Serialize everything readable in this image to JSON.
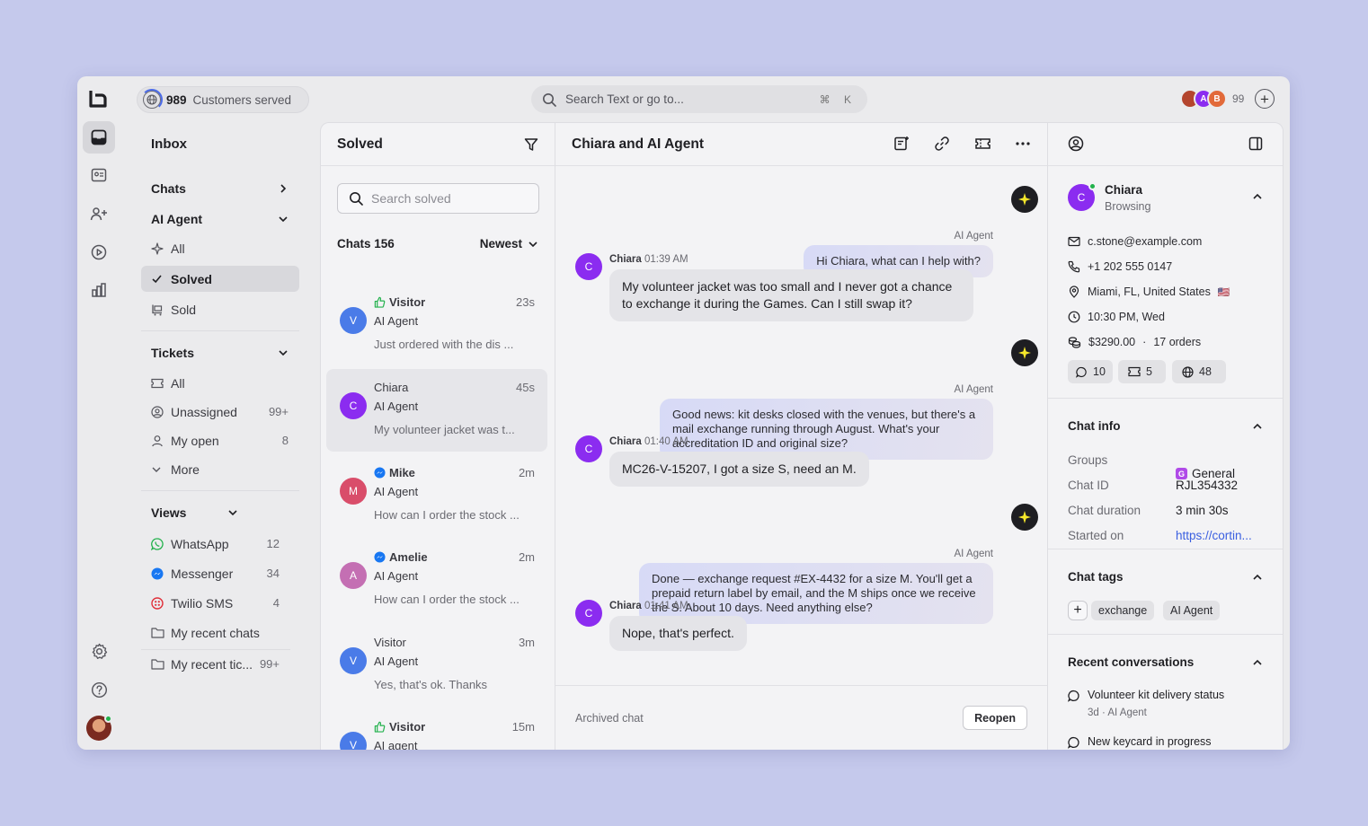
{
  "topbar": {
    "customers_count": "989",
    "customers_label": "Customers served",
    "search_placeholder": "Search Text or go to...",
    "search_shortcut": "⌘ K",
    "team_avatars": [
      {
        "initial": "",
        "color": "#b4452e"
      },
      {
        "initial": "A",
        "color": "#8b2cf0"
      },
      {
        "initial": "B",
        "color": "#e26a3a"
      }
    ],
    "team_count": "99"
  },
  "sidebar": {
    "title": "Inbox",
    "chats": "Chats",
    "ai_agent": "AI Agent",
    "ai_items": [
      {
        "label": "All",
        "icon": "sparkle-icon"
      },
      {
        "label": "Solved",
        "icon": "check-icon"
      },
      {
        "label": "Sold",
        "icon": "cart-icon"
      }
    ],
    "tickets": "Tickets",
    "ticket_items": [
      {
        "label": "All",
        "icon": "ticket-icon",
        "count": ""
      },
      {
        "label": "Unassigned",
        "icon": "user-circle-icon",
        "count": "99+"
      },
      {
        "label": "My open",
        "icon": "user-icon",
        "count": "8"
      },
      {
        "label": "More",
        "icon": "chevron-down-icon",
        "count": ""
      }
    ],
    "views": "Views",
    "view_items": [
      {
        "label": "WhatsApp",
        "count": "12"
      },
      {
        "label": "Messenger",
        "count": "34"
      },
      {
        "label": "Twilio SMS",
        "count": "4"
      },
      {
        "label": "My recent chats",
        "count": ""
      },
      {
        "label": "My recent tic...",
        "count": "99+"
      }
    ]
  },
  "list": {
    "title": "Solved",
    "search_placeholder": "Search solved",
    "count_label": "Chats 156",
    "sort": "Newest",
    "items": [
      {
        "initial": "V",
        "color": "#4a7be8",
        "name": "Visitor",
        "channel": "whatsapp",
        "time": "23s",
        "agent": "AI Agent",
        "preview": "Just ordered with the dis ..."
      },
      {
        "initial": "C",
        "color": "#8b2cf0",
        "name": "Chiara",
        "channel": "",
        "time": "45s",
        "agent": "AI Agent",
        "preview": "My volunteer jacket was t..."
      },
      {
        "initial": "M",
        "color": "#d94d6a",
        "name": "Mike",
        "channel": "messenger",
        "time": "2m",
        "agent": "AI Agent",
        "preview": "How can I order the stock ..."
      },
      {
        "initial": "A",
        "color": "#c46fb3",
        "name": "Amelie",
        "channel": "messenger",
        "time": "2m",
        "agent": "AI Agent",
        "preview": "How can I order the stock ..."
      },
      {
        "initial": "V",
        "color": "#4a7be8",
        "name": "Visitor",
        "channel": "",
        "time": "3m",
        "agent": "AI Agent",
        "preview": "Yes, that's ok. Thanks"
      },
      {
        "initial": "V",
        "color": "#4a7be8",
        "name": "Visitor",
        "channel": "whatsapp",
        "time": "15m",
        "agent": "AI agent",
        "preview": ""
      }
    ]
  },
  "chat": {
    "title": "Chiara and AI Agent",
    "messages": [
      {
        "from": "ai",
        "label": "AI Agent",
        "text": "Hi Chiara, what can I help with?"
      },
      {
        "from": "user",
        "initial": "C",
        "name": "Chiara",
        "time": "01:39 AM",
        "text": "My volunteer jacket was too small and I never got a chance to exchange it during the Games. Can I still swap it?"
      },
      {
        "from": "ai",
        "label": "AI Agent",
        "text": "Good news: kit desks closed with the venues, but there's a mail exchange running through August. What's your accreditation ID and original size?"
      },
      {
        "from": "user",
        "initial": "C",
        "name": "Chiara",
        "time": "01:40 AM",
        "text": "MC26-V-15207, I got a size S, need an M."
      },
      {
        "from": "ai",
        "label": "AI Agent",
        "text": "Done — exchange request #EX-4432 for a size M. You'll get a prepaid return label by email, and the M ships once we receive the S. About 10 days. Need anything else?"
      },
      {
        "from": "user",
        "initial": "C",
        "name": "Chiara",
        "time": "01:41 AM",
        "text": "Nope, that's perfect."
      }
    ],
    "footer_status": "Archived chat",
    "reopen_label": "Reopen"
  },
  "customer": {
    "initial": "C",
    "name": "Chiara",
    "status": "Browsing",
    "email": "c.stone@example.com",
    "phone": "+1 202 555 0147",
    "location": "Miami, FL, United States",
    "flag": "🇺🇸",
    "local_time": "10:30 PM, Wed",
    "spent": "$3290.00",
    "orders": "17 orders",
    "stats": [
      {
        "icon": "chat-bubble-icon",
        "value": "10"
      },
      {
        "icon": "ticket-icon",
        "value": "5"
      },
      {
        "icon": "globe-icon",
        "value": "48"
      }
    ]
  },
  "chat_info": {
    "title": "Chat info",
    "rows": [
      {
        "key": "Groups",
        "value": "General",
        "badge": "G"
      },
      {
        "key": "Chat ID",
        "value": "RJL354332"
      },
      {
        "key": "Chat duration",
        "value": "3 min 30s"
      },
      {
        "key": "Started on",
        "value": "https://cortin..."
      }
    ]
  },
  "chat_tags": {
    "title": "Chat tags",
    "tags": [
      "exchange",
      "AI Agent"
    ]
  },
  "recent": {
    "title": "Recent conversations",
    "items": [
      {
        "title": "Volunteer kit delivery status",
        "meta": "3d · AI Agent"
      },
      {
        "title": "New keycard in progress",
        "meta": ""
      }
    ]
  },
  "colors": {
    "background": "#c5c9ec",
    "accent": "#8b2cf0",
    "link": "#3a5fe0",
    "online": "#22b14c"
  }
}
